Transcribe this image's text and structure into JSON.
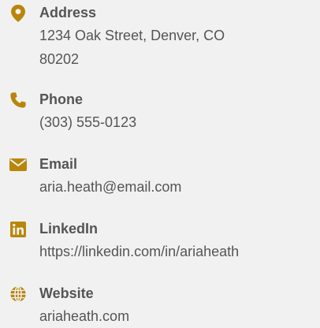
{
  "accent_color": "#b8860b",
  "text_color": "#555555",
  "background_color": "#f1f1f1",
  "contacts": [
    {
      "label": "Address",
      "value": "1234 Oak Street, Denver, CO 80202",
      "icon": "location-pin-icon"
    },
    {
      "label": "Phone",
      "value": "(303) 555-0123",
      "icon": "phone-icon"
    },
    {
      "label": "Email",
      "value": "aria.heath@email.com",
      "icon": "envelope-icon"
    },
    {
      "label": "LinkedIn",
      "value": "https://linkedin.com/in/ariaheath",
      "icon": "linkedin-icon"
    },
    {
      "label": "Website",
      "value": "ariaheath.com",
      "icon": "globe-icon"
    }
  ]
}
